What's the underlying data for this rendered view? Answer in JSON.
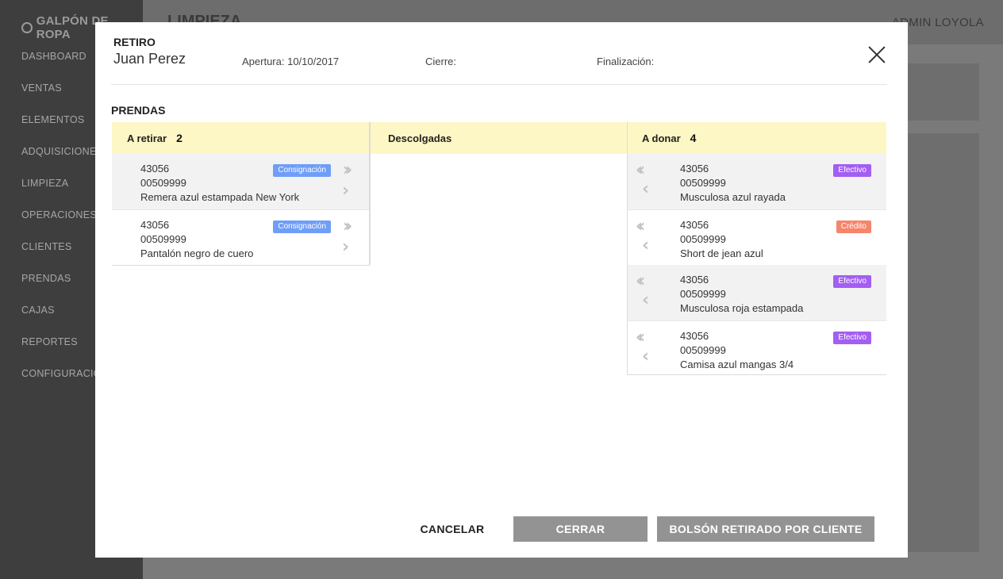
{
  "app": {
    "brand": "GALPÓN DE ROPA",
    "page_title": "LIMPIEZA",
    "user": "ADMIN LOYOLA",
    "nav": [
      "DASHBOARD",
      "VENTAS",
      "ELEMENTOS",
      "ADQUISICIONES",
      "LIMPIEZA",
      "OPERACIONES",
      "CLIENTES",
      "PRENDAS",
      "CAJAS",
      "REPORTES",
      "CONFIGURACIÓN"
    ]
  },
  "modal": {
    "type_label": "RETIRO",
    "client_name": "Juan Perez",
    "apertura": "Apertura: 10/10/2017",
    "cierre": "Cierre:",
    "finalizacion": "Finalización:",
    "section_title": "PRENDAS",
    "columns": {
      "a_retirar": {
        "label": "A retirar",
        "count": "2",
        "items": [
          {
            "code": "43056",
            "sku": "00509999",
            "desc": "Remera azul estampada New York",
            "badge": "Consignación",
            "badge_color": "#6f9ef8"
          },
          {
            "code": "43056",
            "sku": "00509999",
            "desc": "Pantalón negro de cuero",
            "badge": "Consignación",
            "badge_color": "#6f9ef8"
          }
        ]
      },
      "descolgadas": {
        "label": "Descolgadas"
      },
      "a_donar": {
        "label": "A donar",
        "count": "4",
        "items": [
          {
            "code": "43056",
            "sku": "00509999",
            "desc": "Musculosa azul rayada",
            "badge": "Efectivo",
            "badge_color": "#a35ef2"
          },
          {
            "code": "43056",
            "sku": "00509999",
            "desc": "Short de jean azul",
            "badge": "Crédito",
            "badge_color": "#f5856b"
          },
          {
            "code": "43056",
            "sku": "00509999",
            "desc": "Musculosa roja estampada",
            "badge": "Efectivo",
            "badge_color": "#a35ef2"
          },
          {
            "code": "43056",
            "sku": "00509999",
            "desc": "Camisa azul mangas 3/4",
            "badge": "Efectivo",
            "badge_color": "#a35ef2"
          }
        ]
      }
    },
    "buttons": {
      "cancel": "CANCELAR",
      "cerrar": "CERRAR",
      "bolson": "BOLSÓN RETIRADO POR CLIENTE"
    },
    "icons": {
      "close": "close-icon",
      "move_all_right": "double-chevron-right-icon",
      "move_right": "chevron-right-icon",
      "move_all_left": "double-chevron-left-icon",
      "move_left": "chevron-left-icon"
    }
  }
}
